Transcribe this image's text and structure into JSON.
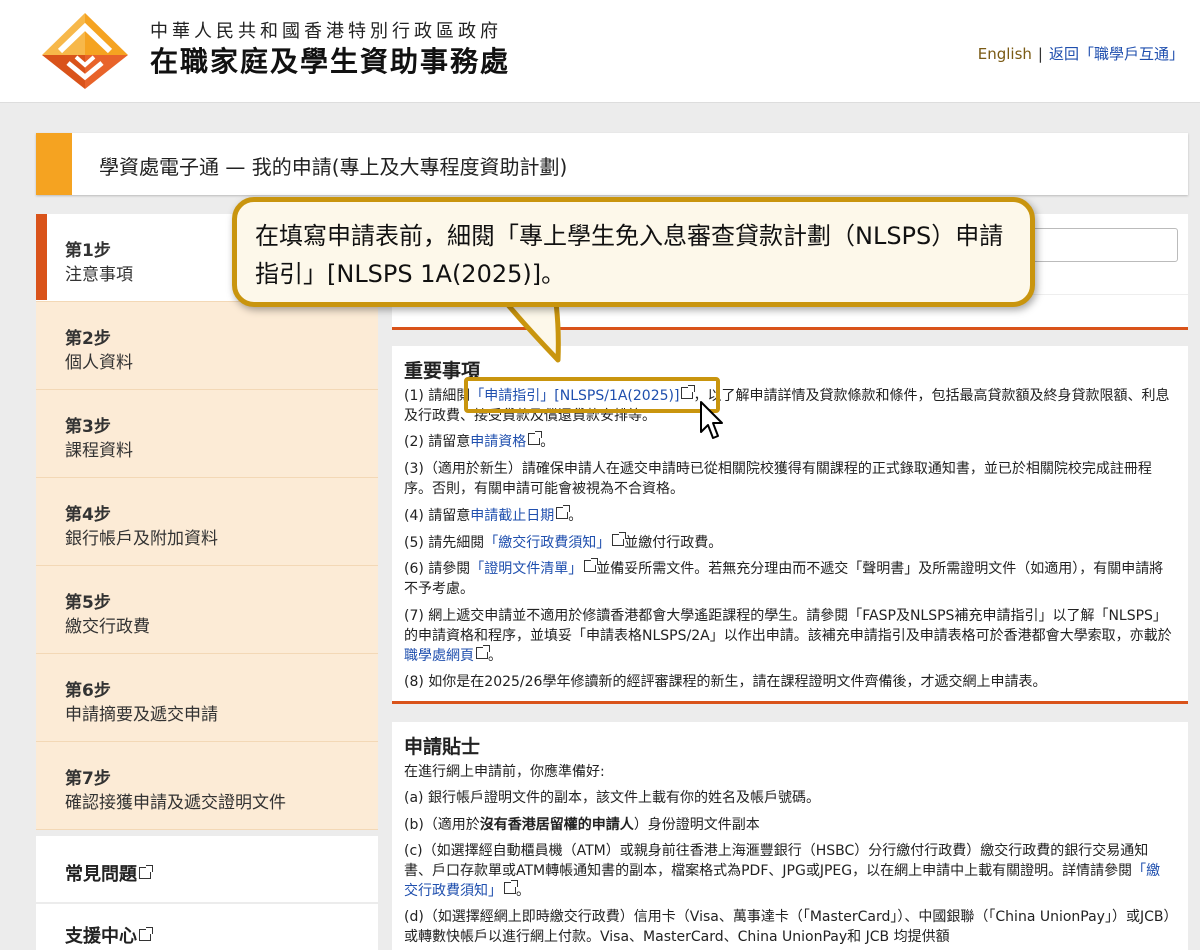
{
  "header": {
    "org_line1": "中華人民共和國香港特別行政區政府",
    "org_line2": "在職家庭及學生資助事務處",
    "lang_link": "English",
    "separator": "|",
    "back_link": "返回「職學戶互通」"
  },
  "page_title": "學資處電子通 — 我的申請(專上及大專程度資助計劃)",
  "sidebar": {
    "steps": [
      {
        "num": "第1步",
        "label": "注意事項"
      },
      {
        "num": "第2步",
        "label": "個人資料"
      },
      {
        "num": "第3步",
        "label": "課程資料"
      },
      {
        "num": "第4步",
        "label": "銀行帳戶及附加資料"
      },
      {
        "num": "第5步",
        "label": "繳交行政費"
      },
      {
        "num": "第6步",
        "label": "申請摘要及遞交申請"
      },
      {
        "num": "第7步",
        "label": "確認接獲申請及遞交證明文件"
      }
    ],
    "faq": "常見問題",
    "support": "支援中心"
  },
  "callout": {
    "text": "在填寫申請表前，細閱「專上學生免入息審查貸款計劃（NLSPS）申請指引」[NLSPS 1A(2025)]。"
  },
  "important": {
    "title": "重要事項",
    "items": [
      {
        "pre": "(1) 請細閱",
        "link": "「申請指引」[NLSPS/1A(2025)]",
        "post": "，以了解申請詳情及貸款條款和條件，包括最高貸款額及終身貸款限額、利息及行政費、接受貸款及償還貸款安排等。"
      },
      {
        "pre": "(2) 請留意",
        "link": "申請資格",
        "post": "。"
      },
      {
        "pre": "(3)（適用於新生）請確保申請人在遞交申請時已從相關院校獲得有關課程的正式錄取通知書，並已於相關院校完成註冊程序。否則，有關申請可能會被視為不合資格。",
        "link": "",
        "post": ""
      },
      {
        "pre": "(4) 請留意",
        "link": "申請截止日期",
        "post": "。"
      },
      {
        "pre": "(5) 請先細閱",
        "link": "「繳交行政費須知」",
        "post": "並繳付行政費。"
      },
      {
        "pre": "(6) 請參閱",
        "link": "「證明文件清單」",
        "post": "並備妥所需文件。若無充分理由而不遞交「聲明書」及所需證明文件（如適用），有關申請將不予考慮。"
      },
      {
        "pre": "(7) 網上遞交申請並不適用於修讀香港都會大學遙距課程的學生。請參閱「FASP及NLSPS補充申請指引」以了解「NLSPS」的申請資格和程序，並填妥「申請表格NLSPS/2A」以作出申請。該補充申請指引及申請表格可於香港都會大學索取，亦載於",
        "link": "職學處網頁",
        "post": "。"
      },
      {
        "pre": "(8) 如你是在2025/26學年修讀新的經評審課程的新生，請在課程證明文件齊備後，才遞交網上申請表。",
        "link": "",
        "post": ""
      }
    ]
  },
  "tips": {
    "title": "申請貼士",
    "intro": "在進行網上申請前，你應準備好:",
    "items": [
      {
        "pre": "(a) 銀行帳戶證明文件的副本，該文件上載有你的姓名及帳戶號碼。",
        "link": "",
        "post": ""
      },
      {
        "pre": "(b)（適用於",
        "bold": "沒有香港居留權的申請人",
        "post": "）身份證明文件副本"
      },
      {
        "pre": "(c)（如選擇經自動櫃員機（ATM）或親身前往香港上海滙豐銀行（HSBC）分行繳付行政費）繳交行政費的銀行交易通知書、戶口存款單或ATM轉帳通知書的副本，檔案格式為PDF、JPG或JPEG，以在網上申請中上載有關證明。詳情請參閱",
        "link": "「繳交行政費須知」",
        "post": "。"
      },
      {
        "pre": "(d)（如選擇經網上即時繳交行政費）信用卡（Visa、萬事達卡（「MasterCard」）、中國銀聯（「China UnionPay」）或JCB）或轉數快帳戶以進行網上付款。Visa、MasterCard、China UnionPay和 JCB 均提供額",
        "link": "",
        "post": ""
      }
    ]
  },
  "colors": {
    "accent_orange": "#f5a321",
    "step_active": "#d9531a",
    "link_blue": "#1f4fae",
    "callout_border": "#c9950e"
  }
}
